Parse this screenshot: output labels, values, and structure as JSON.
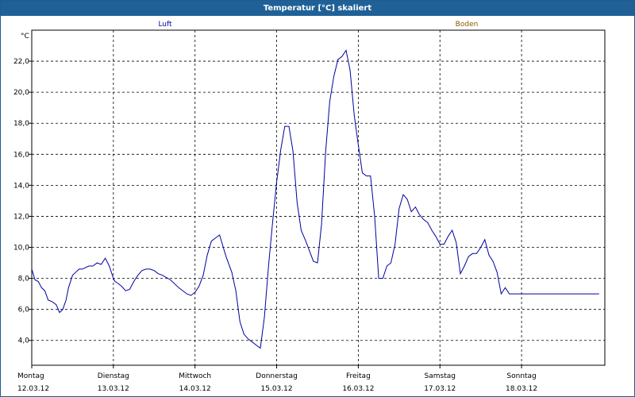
{
  "window": {
    "title": "Temperatur [°C] skaliert"
  },
  "colors": {
    "luft": "#0000a0",
    "boden": "#8b5a00",
    "grid": "#000000"
  },
  "chart_data": {
    "type": "line",
    "title": "Temperatur [°C] skaliert",
    "ylabel": "°C",
    "ylim": [
      2.4,
      24.0
    ],
    "xlim": [
      0,
      7.02
    ],
    "grid": true,
    "y_ticks": [
      "4,0",
      "6,0",
      "8,0",
      "10,0",
      "12,0",
      "14,0",
      "16,0",
      "18,0",
      "20,0",
      "22,0"
    ],
    "y_tick_values": [
      4,
      6,
      8,
      10,
      12,
      14,
      16,
      18,
      20,
      22
    ],
    "x_ticks": [
      {
        "day": "Montag",
        "date": "12.03.12"
      },
      {
        "day": "Dienstag",
        "date": "13.03.12"
      },
      {
        "day": "Mittwoch",
        "date": "14.03.12"
      },
      {
        "day": "Donnerstag",
        "date": "15.03.12"
      },
      {
        "day": "Freitag",
        "date": "16.03.12"
      },
      {
        "day": "Samstag",
        "date": "17.03.12"
      },
      {
        "day": "Sonntag",
        "date": "18.03.12"
      }
    ],
    "legend": [
      "Luft",
      "Boden"
    ],
    "series": [
      {
        "name": "Luft",
        "x": [
          0.0,
          0.04,
          0.08,
          0.12,
          0.16,
          0.2,
          0.25,
          0.3,
          0.34,
          0.38,
          0.42,
          0.45,
          0.5,
          0.54,
          0.58,
          0.62,
          0.66,
          0.7,
          0.75,
          0.8,
          0.85,
          0.9,
          0.95,
          1.0,
          1.02,
          1.05,
          1.1,
          1.15,
          1.2,
          1.25,
          1.3,
          1.35,
          1.4,
          1.45,
          1.5,
          1.55,
          1.6,
          1.7,
          1.8,
          1.9,
          1.95,
          2.0,
          2.05,
          2.1,
          2.15,
          2.2,
          2.3,
          2.38,
          2.45,
          2.5,
          2.55,
          2.6,
          2.65,
          2.7,
          2.75,
          2.8,
          2.85,
          2.9,
          2.95,
          3.0,
          3.05,
          3.1,
          3.15,
          3.2,
          3.25,
          3.3,
          3.35,
          3.4,
          3.45,
          3.5,
          3.55,
          3.6,
          3.65,
          3.7,
          3.75,
          3.8,
          3.85,
          3.9,
          3.95,
          4.0,
          4.05,
          4.1,
          4.15,
          4.2,
          4.25,
          4.3,
          4.35,
          4.4,
          4.45,
          4.5,
          4.55,
          4.6,
          4.65,
          4.7,
          4.72,
          4.75,
          4.8,
          4.85,
          4.9,
          4.95,
          5.0,
          5.05,
          5.1,
          5.15,
          5.2,
          5.25,
          5.3,
          5.35,
          5.4,
          5.45,
          5.5,
          5.55,
          5.6,
          5.65,
          5.7,
          5.75,
          5.8,
          5.85,
          5.9,
          5.95,
          6.0,
          6.05,
          6.1,
          6.15,
          6.2,
          6.25,
          6.3,
          6.35,
          6.4,
          6.45,
          6.5,
          6.55,
          6.6,
          6.65,
          6.7,
          6.75,
          6.8,
          6.85,
          6.9,
          6.95,
          7.0
        ],
        "y": [
          8.6,
          7.9,
          7.8,
          7.4,
          7.2,
          6.6,
          6.5,
          6.3,
          5.8,
          6.0,
          6.6,
          7.4,
          8.2,
          8.4,
          8.6,
          8.6,
          8.7,
          8.8,
          8.8,
          9.0,
          8.9,
          9.3,
          8.8,
          8.0,
          7.8,
          7.7,
          7.5,
          7.2,
          7.3,
          7.8,
          8.2,
          8.5,
          8.6,
          8.6,
          8.5,
          8.3,
          8.2,
          7.9,
          7.4,
          7.0,
          6.9,
          7.1,
          7.5,
          8.2,
          9.5,
          10.4,
          10.8,
          9.4,
          8.4,
          7.2,
          5.2,
          4.4,
          4.1,
          3.9,
          3.7,
          3.5,
          5.5,
          8.8,
          11.6,
          14.2,
          16.3,
          17.8,
          17.8,
          16.2,
          12.9,
          11.1,
          10.5,
          9.8,
          9.1,
          9.0,
          11.5,
          16.2,
          19.4,
          21.0,
          22.1,
          22.3,
          22.7,
          21.4,
          18.5,
          16.6,
          14.8,
          14.6,
          14.6,
          12.0,
          8.0,
          8.0,
          8.8,
          9.0,
          10.2,
          12.5,
          13.4,
          13.1,
          12.3,
          12.6,
          12.4,
          12.1,
          11.8,
          11.6,
          11.1,
          10.7,
          10.2,
          10.2,
          10.7,
          11.1,
          10.3,
          8.3,
          8.8,
          9.4,
          9.6,
          9.6,
          10.0,
          10.5,
          9.5,
          9.1,
          8.4,
          7.0,
          7.4,
          7.0,
          7.0,
          7.0,
          7.0,
          7.0,
          7.0,
          7.0,
          7.0,
          7.0,
          7.0,
          7.0,
          7.0,
          7.0,
          7.0,
          7.0,
          7.0,
          7.0,
          7.0,
          7.0,
          7.0,
          7.0,
          7.0,
          7.0,
          7.0
        ]
      }
    ]
  }
}
